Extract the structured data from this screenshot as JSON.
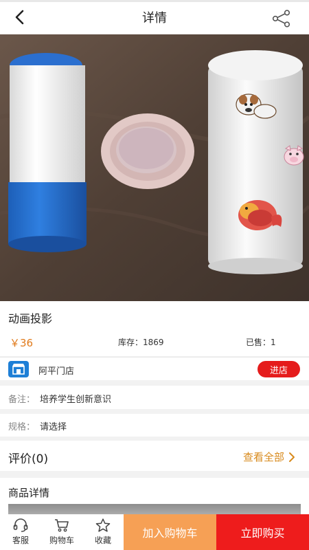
{
  "header": {
    "title": "详情"
  },
  "product": {
    "name": "动画投影",
    "price": "￥36",
    "stock": "库存：1869",
    "sold": "已售：1"
  },
  "store": {
    "name": "阿平门店",
    "enter_label": "进店"
  },
  "remark": {
    "label": "备注：",
    "value": "培养学生创新意识"
  },
  "spec": {
    "label": "规格：",
    "value": "请选择"
  },
  "review": {
    "title": "评价(0)",
    "all_label": "查看全部"
  },
  "detail": {
    "title": "商品详情"
  },
  "bottom": {
    "service": "客服",
    "cart": "购物车",
    "favorite": "收藏",
    "add_to_cart": "加入购物车",
    "buy_now": "立即购买"
  },
  "colors": {
    "price": "#e07a1b",
    "store_icon": "#1e7fd6",
    "enter_button": "#e51c1c",
    "add_to_cart": "#f6a055",
    "buy_now": "#ee1c1c",
    "review_link": "#d88a1c"
  }
}
